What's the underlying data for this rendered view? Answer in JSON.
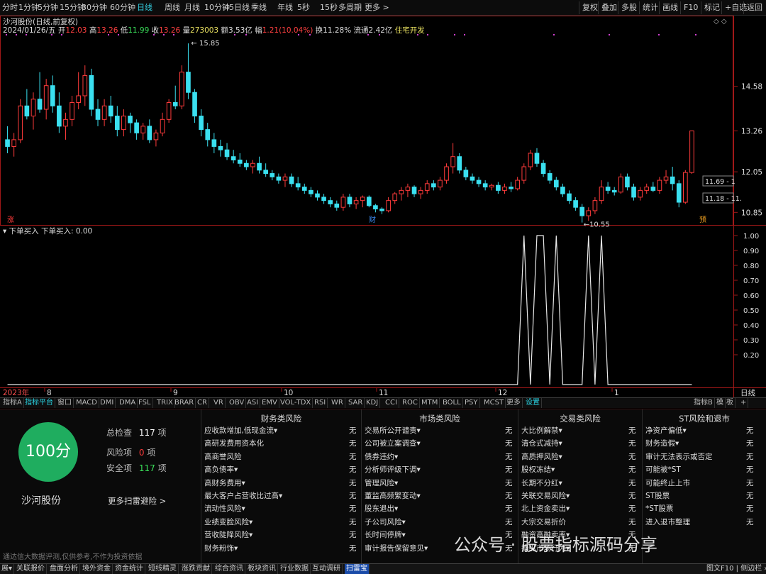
{
  "periods": [
    "分时",
    "1分钟",
    "5分钟",
    "15分钟",
    "30分钟",
    "60分钟",
    "日线",
    "周线",
    "月线",
    "10分钟",
    "45日线",
    "季线",
    "年线",
    "5秒",
    "15秒",
    "多周期",
    "更多 >"
  ],
  "active_period": "日线",
  "toolbar": [
    "复权",
    "叠加",
    "多股",
    "统计",
    "画线",
    "F10",
    "标记",
    "+自选",
    "返回"
  ],
  "header": {
    "title": "沙河股份(日线,前复权)",
    "date": "2024/01/26/五",
    "open_label": "开",
    "open": "12.03",
    "high_label": "高",
    "high": "13.26",
    "low_label": "低",
    "low": "11.99",
    "close_label": "收",
    "close": "13.26",
    "vol_label": "量",
    "vol": "273003",
    "amt_label": "额",
    "amt": "3.53亿",
    "chg_label": "幅",
    "chg": "1.21(10.04%)",
    "turn_label": "换",
    "turn": "11.28%",
    "float_label": "流通",
    "float": "2.42亿",
    "sector": "住宅开发"
  },
  "win_controls": "◇ ◇",
  "price_axis": [
    "14.58",
    "13.26",
    "12.05",
    "10.85"
  ],
  "annotations": {
    "high": "15.85",
    "low": "10.55",
    "tag_zhang": "涨",
    "tag_cai": "财",
    "tag_yu": "预",
    "box1": "11.69 - 1",
    "box2": "11.18 - 11."
  },
  "time_axis": [
    "2023年",
    "8",
    "9",
    "10",
    "11",
    "12",
    "1",
    "日线"
  ],
  "indicator": {
    "title": "下单买入",
    "value_label": "下单买入: 0.00",
    "axis": [
      "1.00",
      "0.90",
      "0.80",
      "0.70",
      "0.60",
      "0.50",
      "0.40",
      "0.30",
      "0.20"
    ]
  },
  "indicator_tabs": [
    "指标A",
    "指标平台",
    "窗口",
    "MACD",
    "DMI",
    "DMA",
    "FSL",
    "TRIX",
    "BRAR",
    "CR",
    "VR",
    "OBV",
    "ASI",
    "EMV",
    "VOL-TDX",
    "RSI",
    "WR",
    "SAR",
    "KDJ",
    "CCI",
    "ROC",
    "MTM",
    "BOLL",
    "PSY",
    "MCST",
    "更多",
    "设置"
  ],
  "indicator_tabs_right": [
    "指标B",
    "模",
    "板",
    "+"
  ],
  "scan": {
    "score": "100分",
    "stock": "沙河股份",
    "total_label": "总检查",
    "total": "117",
    "total_unit": "项",
    "risk_label": "风险项",
    "risk": "0",
    "risk_unit": "项",
    "safe_label": "安全项",
    "safe": "117",
    "safe_unit": "项",
    "more": "更多扫雷避险 >",
    "disclaimer": "通达信大数据评测,仅供参考,不作为投资依据"
  },
  "risk_columns": [
    {
      "title": "财务类风险",
      "items": [
        "应收款增加,低现金流▾",
        "高研发费用资本化",
        "高商誉风险",
        "高负债率▾",
        "高财务费用▾",
        "最大客户占营收比过高▾",
        "流动性风险▾",
        "业绩变脸风险▾",
        "营收陡降风险▾",
        "财务粉饰▾"
      ]
    },
    {
      "title": "市场类风险",
      "items": [
        "交易所公开谴责▾",
        "公司被立案调查▾",
        "债券违约▾",
        "分析师评级下调▾",
        "管理风险▾",
        "董监高频繁变动▾",
        "股东退出▾",
        "子公司风险▾",
        "长时间停牌▾",
        "审计报告保留意见▾"
      ]
    },
    {
      "title": "交易类风险",
      "items": [
        "大比例解禁▾",
        "清仓式减持▾",
        "高质押风险▾",
        "股权冻结▾",
        "长期不分红▾",
        "关联交易风险▾",
        "北上资金卖出▾",
        "大宗交易折价",
        "融资高融卖率▾",
        "操纵市场行为▾"
      ]
    },
    {
      "title": "ST风险和退市",
      "items": [
        "净资产偏低▾",
        "财务造假▾",
        "审计无法表示或否定",
        "可能被*ST",
        "可能终止上市",
        "ST股票",
        "*ST股票",
        "进入退市整理"
      ]
    }
  ],
  "none_text": "无",
  "bottom_tabs": [
    "展▾",
    "关联报价",
    "盘面分析",
    "境外资金",
    "资金统计",
    "短线精灵",
    "涨跌贡献",
    "综合资讯",
    "板块资讯",
    "行业数据",
    "互动调研",
    "扫雷宝"
  ],
  "bottom_active": "扫雷宝",
  "bottom_right": "图文F10 | 侧边栏 »",
  "watermark": "公众号 · 股票指标源码分享",
  "colors": {
    "up": "#ff3b3b",
    "down": "#3ae0f0",
    "ma": "#ffffff",
    "score": "#1fad5f",
    "axis": "#a01818"
  },
  "chart_data": {
    "type": "candlestick",
    "ohlc": [
      [
        13.0,
        13.4,
        12.6,
        12.8
      ],
      [
        12.8,
        13.2,
        12.5,
        13.0
      ],
      [
        13.0,
        14.2,
        12.9,
        14.0
      ],
      [
        14.0,
        14.5,
        13.6,
        13.7
      ],
      [
        13.7,
        14.4,
        13.3,
        14.2
      ],
      [
        14.2,
        15.0,
        13.8,
        13.9
      ],
      [
        13.9,
        14.8,
        13.6,
        14.6
      ],
      [
        14.6,
        14.9,
        13.8,
        14.0
      ],
      [
        14.0,
        14.4,
        13.2,
        13.4
      ],
      [
        13.4,
        13.8,
        13.0,
        13.6
      ],
      [
        13.6,
        14.3,
        13.4,
        14.1
      ],
      [
        14.1,
        15.0,
        13.9,
        14.3
      ],
      [
        14.3,
        15.2,
        14.0,
        14.9
      ],
      [
        14.9,
        15.1,
        13.7,
        13.9
      ],
      [
        13.9,
        14.2,
        13.4,
        13.6
      ],
      [
        13.6,
        14.2,
        13.4,
        14.0
      ],
      [
        14.0,
        14.3,
        13.5,
        13.7
      ],
      [
        13.7,
        14.0,
        13.1,
        13.3
      ],
      [
        13.3,
        13.9,
        13.1,
        13.7
      ],
      [
        13.7,
        13.8,
        13.2,
        13.5
      ],
      [
        13.5,
        13.6,
        13.0,
        13.2
      ],
      [
        13.2,
        13.5,
        13.0,
        13.4
      ],
      [
        13.4,
        13.6,
        12.9,
        13.0
      ],
      [
        13.0,
        13.3,
        12.8,
        13.2
      ],
      [
        13.2,
        13.8,
        13.1,
        13.6
      ],
      [
        13.6,
        14.2,
        13.5,
        14.1
      ],
      [
        14.1,
        14.6,
        13.9,
        14.0
      ],
      [
        14.0,
        15.2,
        13.9,
        15.0
      ],
      [
        15.0,
        15.85,
        14.2,
        14.4
      ],
      [
        14.4,
        14.5,
        13.5,
        13.7
      ],
      [
        13.7,
        13.9,
        13.1,
        13.3
      ],
      [
        13.3,
        13.5,
        12.8,
        13.0
      ],
      [
        13.0,
        13.2,
        12.6,
        12.8
      ],
      [
        12.8,
        13.0,
        12.5,
        12.7
      ],
      [
        12.7,
        12.9,
        12.4,
        12.5
      ],
      [
        12.5,
        12.7,
        12.3,
        12.4
      ],
      [
        12.4,
        12.6,
        12.2,
        12.3
      ],
      [
        12.3,
        12.4,
        12.1,
        12.2
      ],
      [
        12.2,
        12.4,
        12.0,
        12.3
      ],
      [
        12.3,
        12.5,
        12.0,
        12.1
      ],
      [
        12.1,
        12.3,
        11.9,
        12.0
      ],
      [
        12.0,
        12.1,
        11.8,
        11.9
      ],
      [
        11.9,
        12.0,
        11.7,
        11.8
      ],
      [
        11.8,
        12.0,
        11.6,
        11.9
      ],
      [
        11.9,
        12.0,
        11.6,
        11.7
      ],
      [
        11.7,
        11.9,
        11.5,
        11.6
      ],
      [
        11.6,
        11.7,
        11.4,
        11.5
      ],
      [
        11.5,
        11.6,
        11.3,
        11.4
      ],
      [
        11.4,
        11.5,
        11.2,
        11.3
      ],
      [
        11.3,
        11.4,
        11.1,
        11.2
      ],
      [
        11.2,
        11.3,
        11.0,
        11.1
      ],
      [
        11.1,
        11.2,
        10.9,
        11.0
      ],
      [
        11.0,
        11.4,
        10.9,
        11.3
      ],
      [
        11.3,
        11.4,
        11.0,
        11.1
      ],
      [
        11.1,
        11.3,
        10.95,
        11.2
      ],
      [
        11.2,
        11.35,
        11.0,
        11.3
      ],
      [
        11.3,
        11.35,
        11.0,
        11.05
      ],
      [
        11.05,
        11.1,
        10.85,
        10.95
      ],
      [
        10.95,
        11.0,
        10.8,
        10.9
      ],
      [
        10.9,
        11.3,
        10.85,
        11.2
      ],
      [
        11.2,
        11.45,
        11.1,
        11.4
      ],
      [
        11.4,
        11.6,
        11.2,
        11.5
      ],
      [
        11.5,
        11.7,
        11.3,
        11.6
      ],
      [
        11.6,
        11.65,
        11.3,
        11.4
      ],
      [
        11.4,
        11.6,
        11.25,
        11.5
      ],
      [
        11.5,
        11.8,
        11.4,
        11.7
      ],
      [
        11.7,
        11.8,
        11.5,
        11.6
      ],
      [
        11.6,
        11.9,
        11.5,
        11.8
      ],
      [
        11.8,
        12.3,
        11.7,
        12.2
      ],
      [
        12.2,
        12.9,
        12.0,
        12.5
      ],
      [
        12.5,
        12.6,
        12.0,
        12.1
      ],
      [
        12.1,
        12.2,
        11.8,
        11.9
      ],
      [
        11.9,
        12.0,
        11.7,
        11.8
      ],
      [
        11.8,
        11.9,
        11.6,
        11.7
      ],
      [
        11.7,
        11.8,
        11.5,
        11.6
      ],
      [
        11.6,
        11.7,
        11.5,
        11.65
      ],
      [
        11.65,
        11.75,
        11.4,
        11.5
      ],
      [
        11.5,
        11.7,
        11.4,
        11.6
      ],
      [
        11.6,
        11.75,
        11.45,
        11.55
      ],
      [
        11.55,
        11.9,
        11.5,
        11.8
      ],
      [
        11.8,
        12.3,
        11.7,
        12.2
      ],
      [
        12.2,
        12.7,
        12.1,
        12.6
      ],
      [
        12.6,
        12.75,
        12.2,
        12.3
      ],
      [
        12.3,
        12.4,
        11.9,
        12.0
      ],
      [
        12.0,
        12.1,
        11.7,
        11.8
      ],
      [
        11.8,
        11.9,
        11.5,
        11.6
      ],
      [
        11.6,
        11.7,
        11.3,
        11.4
      ],
      [
        11.4,
        11.5,
        11.1,
        11.2
      ],
      [
        11.2,
        11.3,
        10.9,
        11.0
      ],
      [
        11.0,
        11.1,
        10.55,
        10.75
      ],
      [
        10.75,
        11.0,
        10.6,
        10.9
      ],
      [
        10.9,
        11.3,
        10.8,
        11.2
      ],
      [
        11.2,
        11.8,
        11.1,
        11.6
      ],
      [
        11.6,
        11.75,
        11.4,
        11.5
      ],
      [
        11.5,
        11.6,
        11.35,
        11.45
      ],
      [
        11.45,
        12.0,
        11.4,
        11.9
      ],
      [
        11.9,
        12.0,
        11.5,
        11.6
      ],
      [
        11.6,
        11.7,
        11.2,
        11.3
      ],
      [
        11.3,
        11.6,
        11.2,
        11.5
      ],
      [
        11.5,
        11.7,
        11.4,
        11.6
      ],
      [
        11.6,
        11.75,
        11.45,
        11.5
      ],
      [
        11.5,
        11.9,
        11.4,
        11.8
      ],
      [
        11.8,
        12.1,
        11.7,
        11.9
      ],
      [
        11.9,
        12.2,
        11.5,
        11.7
      ],
      [
        11.7,
        11.8,
        11.0,
        11.15
      ],
      [
        11.15,
        12.1,
        11.1,
        12.03
      ],
      [
        12.03,
        13.26,
        11.99,
        13.26
      ]
    ],
    "signal": [
      0,
      0,
      0,
      0,
      0,
      0,
      0,
      0,
      0,
      0,
      0,
      0,
      0,
      0,
      0,
      0,
      0,
      0,
      0,
      0,
      0,
      0,
      0,
      0,
      0,
      0,
      0,
      0,
      0,
      0,
      0,
      0,
      0,
      0,
      0,
      0,
      0,
      0,
      0,
      0,
      0,
      0,
      0,
      0,
      0,
      0,
      0,
      0,
      0,
      0,
      0,
      0,
      0,
      0,
      0,
      0,
      0,
      0,
      0,
      0,
      0,
      0,
      0,
      0,
      0,
      0,
      0,
      0,
      0,
      0,
      0,
      0,
      0,
      0,
      0,
      0,
      0,
      0,
      0,
      0,
      1,
      0,
      1,
      1,
      0,
      1,
      0,
      0,
      0,
      0,
      1,
      0,
      1,
      0,
      0,
      0,
      0,
      0,
      0,
      0,
      0,
      0,
      0,
      0,
      0,
      0,
      0
    ],
    "signal_ylim": [
      0,
      1
    ],
    "ylim": [
      10.5,
      16.0
    ],
    "ylabel_ticks": [
      14.58,
      13.26,
      12.05,
      10.85
    ],
    "title": "沙河股份(日线,前复权)"
  }
}
